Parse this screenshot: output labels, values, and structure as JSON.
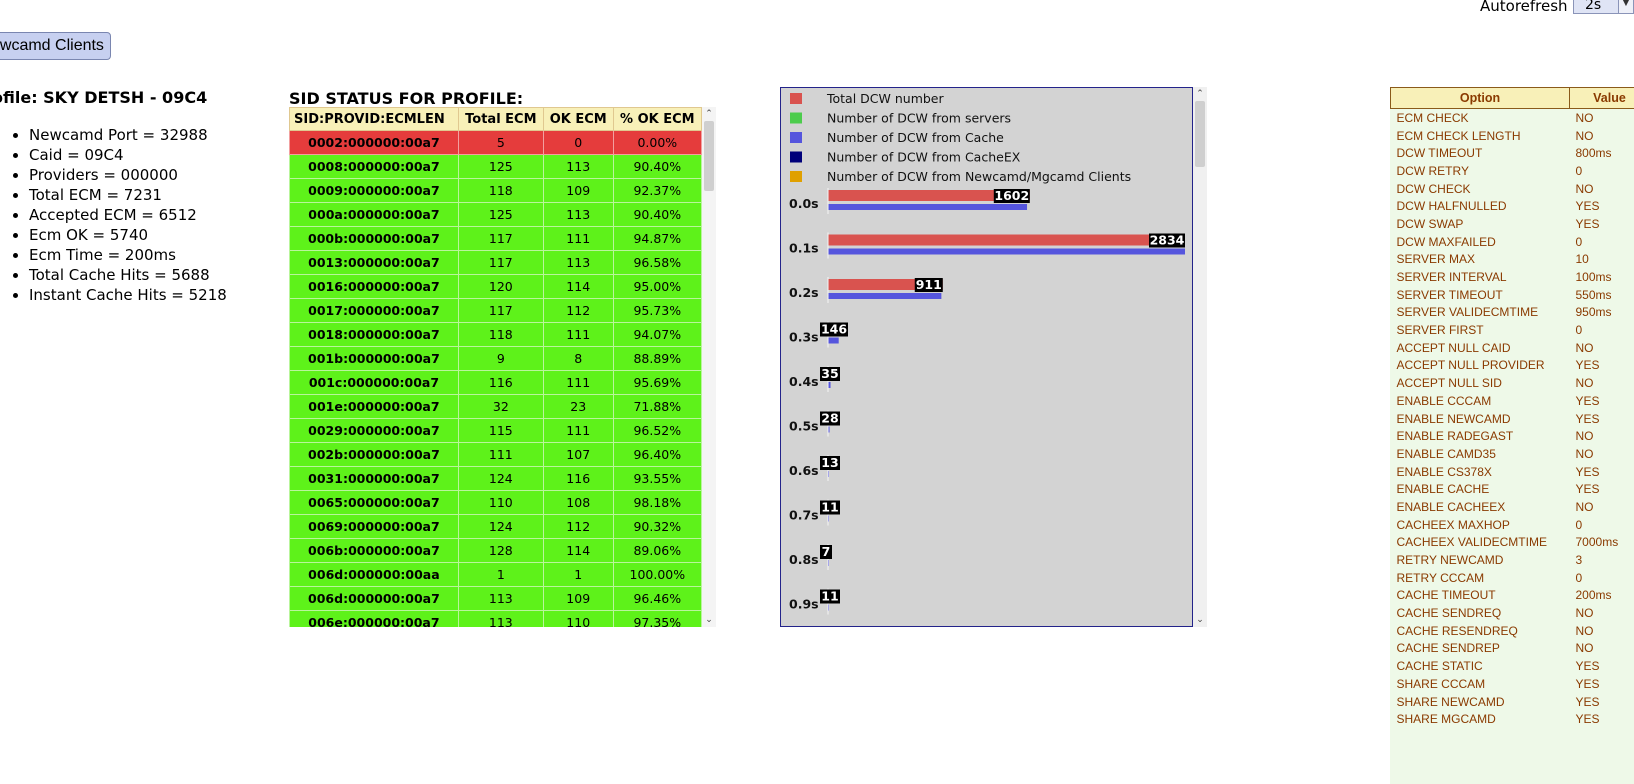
{
  "header": {
    "autorefresh_label": "Autorefresh",
    "autorefresh_value": "2s",
    "newcamd_button": "ewcamd Clients"
  },
  "profile": {
    "title": "ofile: SKY DETSH - 09C4",
    "stats": [
      "Newcamd Port = 32988",
      "Caid = 09C4",
      "Providers = 000000",
      "Total ECM = 7231",
      "Accepted ECM = 6512",
      "Ecm OK = 5740",
      "Ecm Time = 200ms",
      "Total Cache Hits = 5688",
      "Instant Cache Hits = 5218"
    ]
  },
  "sid_status": {
    "title": "SID STATUS FOR PROFILE:",
    "headers": [
      "SID:PROVID:ECMLEN",
      "Total ECM",
      "OK ECM",
      "% OK ECM"
    ],
    "rows": [
      {
        "sid": "0002:000000:00a7",
        "total": "5",
        "ok": "0",
        "pct": "0.00%",
        "status": "bad"
      },
      {
        "sid": "0008:000000:00a7",
        "total": "125",
        "ok": "113",
        "pct": "90.40%",
        "status": "good"
      },
      {
        "sid": "0009:000000:00a7",
        "total": "118",
        "ok": "109",
        "pct": "92.37%",
        "status": "good"
      },
      {
        "sid": "000a:000000:00a7",
        "total": "125",
        "ok": "113",
        "pct": "90.40%",
        "status": "good"
      },
      {
        "sid": "000b:000000:00a7",
        "total": "117",
        "ok": "111",
        "pct": "94.87%",
        "status": "good"
      },
      {
        "sid": "0013:000000:00a7",
        "total": "117",
        "ok": "113",
        "pct": "96.58%",
        "status": "good"
      },
      {
        "sid": "0016:000000:00a7",
        "total": "120",
        "ok": "114",
        "pct": "95.00%",
        "status": "good"
      },
      {
        "sid": "0017:000000:00a7",
        "total": "117",
        "ok": "112",
        "pct": "95.73%",
        "status": "good"
      },
      {
        "sid": "0018:000000:00a7",
        "total": "118",
        "ok": "111",
        "pct": "94.07%",
        "status": "good"
      },
      {
        "sid": "001b:000000:00a7",
        "total": "9",
        "ok": "8",
        "pct": "88.89%",
        "status": "good"
      },
      {
        "sid": "001c:000000:00a7",
        "total": "116",
        "ok": "111",
        "pct": "95.69%",
        "status": "good"
      },
      {
        "sid": "001e:000000:00a7",
        "total": "32",
        "ok": "23",
        "pct": "71.88%",
        "status": "good"
      },
      {
        "sid": "0029:000000:00a7",
        "total": "115",
        "ok": "111",
        "pct": "96.52%",
        "status": "good"
      },
      {
        "sid": "002b:000000:00a7",
        "total": "111",
        "ok": "107",
        "pct": "96.40%",
        "status": "good"
      },
      {
        "sid": "0031:000000:00a7",
        "total": "124",
        "ok": "116",
        "pct": "93.55%",
        "status": "good"
      },
      {
        "sid": "0065:000000:00a7",
        "total": "110",
        "ok": "108",
        "pct": "98.18%",
        "status": "good"
      },
      {
        "sid": "0069:000000:00a7",
        "total": "124",
        "ok": "112",
        "pct": "90.32%",
        "status": "good"
      },
      {
        "sid": "006b:000000:00a7",
        "total": "128",
        "ok": "114",
        "pct": "89.06%",
        "status": "good"
      },
      {
        "sid": "006d:000000:00aa",
        "total": "1",
        "ok": "1",
        "pct": "100.00%",
        "status": "good"
      },
      {
        "sid": "006d:000000:00a7",
        "total": "113",
        "ok": "109",
        "pct": "96.46%",
        "status": "good"
      },
      {
        "sid": "006e:000000:00a7",
        "total": "113",
        "ok": "110",
        "pct": "97.35%",
        "status": "good"
      }
    ]
  },
  "chart_data": {
    "type": "bar",
    "legend": [
      {
        "label": "Total DCW number",
        "color": "#d9534f"
      },
      {
        "label": "Number of DCW from servers",
        "color": "#4ccc4c"
      },
      {
        "label": "Number of DCW from Cache",
        "color": "#5555dd"
      },
      {
        "label": "Number of DCW from CacheEX",
        "color": "#00007a"
      },
      {
        "label": "Number of DCW from Newcamd/Mgcamd Clients",
        "color": "#e0a000"
      }
    ],
    "categories": [
      "0.0s",
      "0.1s",
      "0.2s",
      "0.3s",
      "0.4s",
      "0.5s",
      "0.6s",
      "0.7s",
      "0.8s",
      "0.9s"
    ],
    "series": [
      {
        "name": "Total DCW number",
        "values": [
          1602,
          2834,
          911,
          146,
          35,
          28,
          13,
          11,
          7,
          11
        ]
      },
      {
        "name": "Number of DCW from Cache",
        "values": [
          1580,
          2834,
          900,
          85,
          20,
          12,
          8,
          6,
          4,
          8
        ]
      }
    ],
    "value_labels": [
      "1602",
      "2834",
      "911",
      "146",
      "35",
      "28",
      "13",
      "11",
      "7",
      "11"
    ],
    "xlim": [
      0,
      2834
    ]
  },
  "options": {
    "headers": [
      "Option",
      "Value"
    ],
    "rows": [
      {
        "option": "ECM CHECK",
        "value": "NO"
      },
      {
        "option": "ECM CHECK LENGTH",
        "value": "NO"
      },
      {
        "option": "DCW TIMEOUT",
        "value": "800ms"
      },
      {
        "option": "DCW RETRY",
        "value": "0"
      },
      {
        "option": "DCW CHECK",
        "value": "NO"
      },
      {
        "option": "DCW HALFNULLED",
        "value": "YES"
      },
      {
        "option": "DCW SWAP",
        "value": "YES"
      },
      {
        "option": "DCW MAXFAILED",
        "value": "0"
      },
      {
        "option": "SERVER MAX",
        "value": "10"
      },
      {
        "option": "SERVER INTERVAL",
        "value": "100ms"
      },
      {
        "option": "SERVER TIMEOUT",
        "value": "550ms"
      },
      {
        "option": "SERVER VALIDECMTIME",
        "value": "950ms"
      },
      {
        "option": "SERVER FIRST",
        "value": "0"
      },
      {
        "option": "ACCEPT NULL CAID",
        "value": "NO"
      },
      {
        "option": "ACCEPT NULL PROVIDER",
        "value": "YES"
      },
      {
        "option": "ACCEPT NULL SID",
        "value": "NO"
      },
      {
        "option": "ENABLE CCCAM",
        "value": "YES"
      },
      {
        "option": "ENABLE NEWCAMD",
        "value": "YES"
      },
      {
        "option": "ENABLE RADEGAST",
        "value": "NO"
      },
      {
        "option": "ENABLE CAMD35",
        "value": "NO"
      },
      {
        "option": "ENABLE CS378X",
        "value": "YES"
      },
      {
        "option": "ENABLE CACHE",
        "value": "YES"
      },
      {
        "option": "ENABLE CACHEEX",
        "value": "NO"
      },
      {
        "option": "CACHEEX MAXHOP",
        "value": "0"
      },
      {
        "option": "CACHEEX VALIDECMTIME",
        "value": "7000ms"
      },
      {
        "option": "RETRY NEWCAMD",
        "value": "3"
      },
      {
        "option": "RETRY CCCAM",
        "value": "0"
      },
      {
        "option": "CACHE TIMEOUT",
        "value": "200ms"
      },
      {
        "option": "CACHE SENDREQ",
        "value": "NO"
      },
      {
        "option": "CACHE RESENDREQ",
        "value": "NO"
      },
      {
        "option": "CACHE SENDREP",
        "value": "NO"
      },
      {
        "option": "CACHE STATIC",
        "value": "YES"
      },
      {
        "option": "SHARE CCCAM",
        "value": "YES"
      },
      {
        "option": "SHARE NEWCAMD",
        "value": "YES"
      },
      {
        "option": "SHARE MGCAMD",
        "value": "YES"
      }
    ]
  }
}
